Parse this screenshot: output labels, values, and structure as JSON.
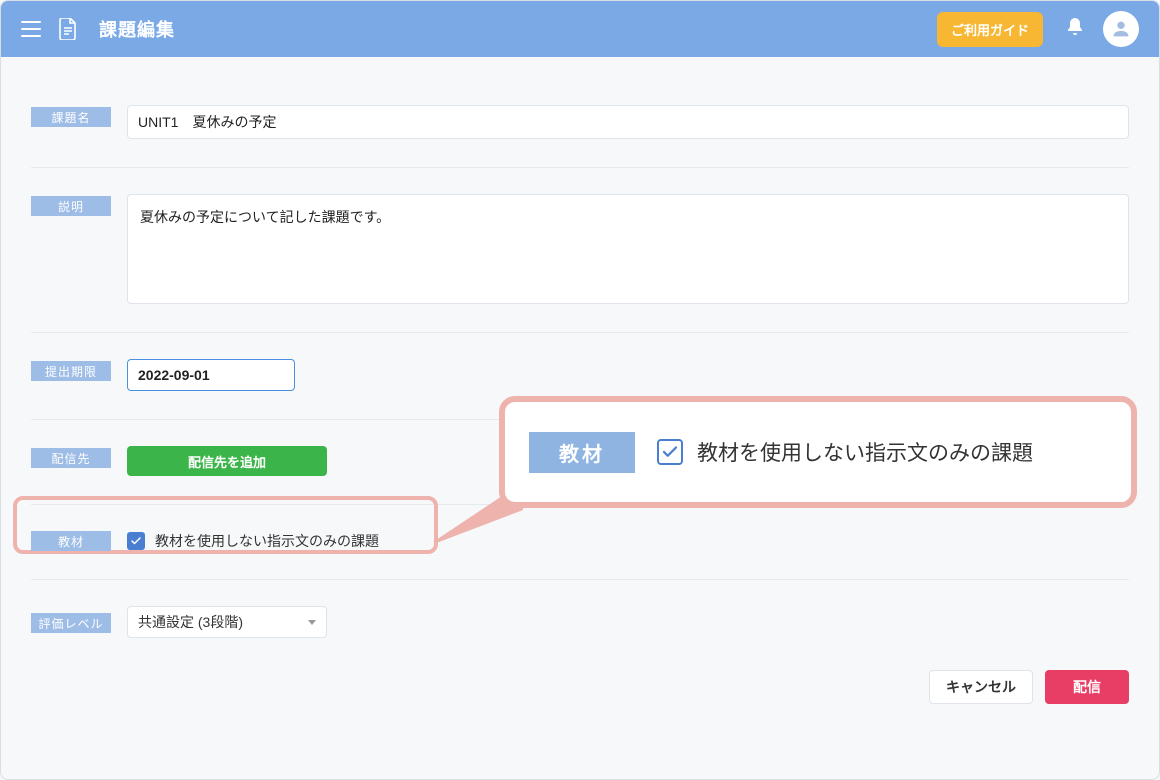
{
  "appbar": {
    "title": "課題編集",
    "guide_button": "ご利用ガイド"
  },
  "form": {
    "title_label": "課題名",
    "title_value": "UNIT1　夏休みの予定",
    "description_label": "説明",
    "description_value": "夏休みの予定について記した課題です。",
    "deadline_label": "提出期限",
    "deadline_value": "2022-09-01",
    "recipients_label": "配信先",
    "add_recipient_button": "配信先を追加",
    "materials_label": "教材",
    "materials_checkbox_label": "教材を使用しない指示文のみの課題",
    "materials_checked": true,
    "rating_label": "評価レベル",
    "rating_value": "共通設定 (3段階)"
  },
  "callout": {
    "big_chip": "教材",
    "big_checkbox_label": "教材を使用しない指示文のみの課題",
    "big_checked": true
  },
  "footer": {
    "cancel": "キャンセル",
    "submit": "配信"
  }
}
